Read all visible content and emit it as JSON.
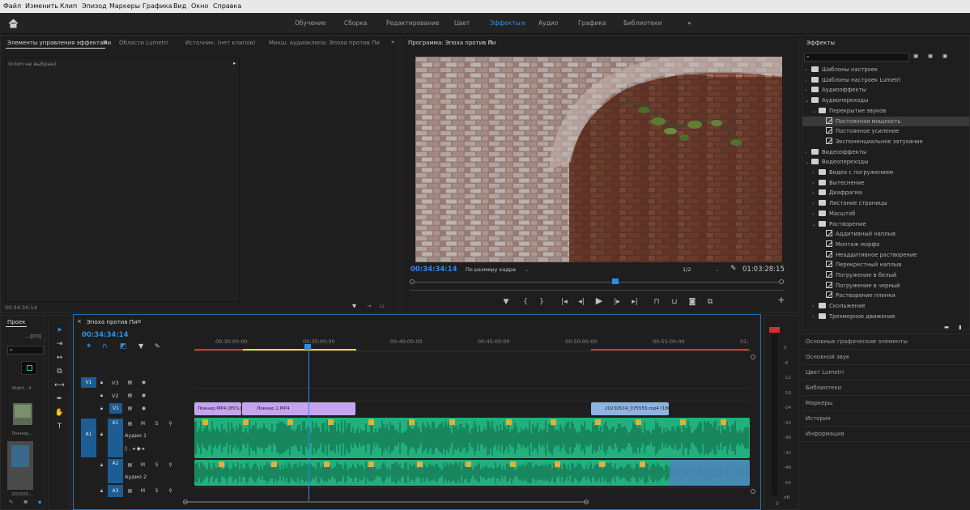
{
  "menu": [
    "Файл",
    "Изменить",
    "Клип",
    "Эпизод",
    "Маркеры",
    "Графика",
    "Вид",
    "Окно",
    "Справка"
  ],
  "workspaces": {
    "items": [
      "Обучение",
      "Сборка",
      "Редактирование",
      "Цвет",
      "Эффекты",
      "Аудио",
      "Графика",
      "Библиотеки"
    ],
    "active": "Эффекты"
  },
  "effect_controls": {
    "tabs": [
      "Элементы управления эффектами",
      "Области Lumetri",
      "Источник: (нет клипов)",
      "Микш. аудиоклипа: Эпоха против Пи"
    ],
    "no_clip": "(клип не выбран)",
    "timecode": "00:34:34:14"
  },
  "program": {
    "title": "Программа: Эпоха против Пи",
    "timecode": "00:34:34:14",
    "fit": "По размеру кадра",
    "resolution": "1/2",
    "duration": "01:03:28:15"
  },
  "effects_panel": {
    "title": "Эффекты",
    "tree": [
      {
        "label": "Шаблоны настроек",
        "level": 0,
        "type": "folder",
        "open": false
      },
      {
        "label": "Шаблоны настроек Lumetri",
        "level": 0,
        "type": "folder",
        "open": false
      },
      {
        "label": "Аудиоэффекты",
        "level": 0,
        "type": "folder",
        "open": false
      },
      {
        "label": "Аудиопереходы",
        "level": 0,
        "type": "folder",
        "open": true
      },
      {
        "label": "Перекрытие звуков",
        "level": 1,
        "type": "folder",
        "open": true
      },
      {
        "label": "Постоянная мощность",
        "level": 2,
        "type": "fx",
        "selected": true
      },
      {
        "label": "Постоянное усиление",
        "level": 2,
        "type": "fx"
      },
      {
        "label": "Экспоненциальное затухание",
        "level": 2,
        "type": "fx"
      },
      {
        "label": "Видеоэффекты",
        "level": 0,
        "type": "folder",
        "open": false
      },
      {
        "label": "Видеопереходы",
        "level": 0,
        "type": "folder",
        "open": true
      },
      {
        "label": "Видео с погружением",
        "level": 1,
        "type": "folder",
        "open": false
      },
      {
        "label": "Вытеснение",
        "level": 1,
        "type": "folder",
        "open": false
      },
      {
        "label": "Диафрагма",
        "level": 1,
        "type": "folder",
        "open": false
      },
      {
        "label": "Листание страницы",
        "level": 1,
        "type": "folder",
        "open": false
      },
      {
        "label": "Масштаб",
        "level": 1,
        "type": "folder",
        "open": false
      },
      {
        "label": "Растворение",
        "level": 1,
        "type": "folder",
        "open": true
      },
      {
        "label": "Аддитивный наплыв",
        "level": 2,
        "type": "fx"
      },
      {
        "label": "Монтаж морфо",
        "level": 2,
        "type": "fx"
      },
      {
        "label": "Неаддитивное растворение",
        "level": 2,
        "type": "fx"
      },
      {
        "label": "Перекрестный наплыв",
        "level": 2,
        "type": "fx"
      },
      {
        "label": "Погружение в белый",
        "level": 2,
        "type": "fx"
      },
      {
        "label": "Погружение в черный",
        "level": 2,
        "type": "fx"
      },
      {
        "label": "Растворение пленки",
        "level": 2,
        "type": "fx"
      },
      {
        "label": "Скольжение",
        "level": 1,
        "type": "folder",
        "open": false
      },
      {
        "label": "Трехмерное движение",
        "level": 1,
        "type": "folder",
        "open": false
      }
    ],
    "sections": [
      "Основные графические элементы",
      "Основной звук",
      "Цвет Lumetri",
      "Библиотеки",
      "Маркеры",
      "История",
      "Информация"
    ]
  },
  "project": {
    "tab": "Проек",
    "items": [
      "Night...4",
      "Локнер...",
      "202305..."
    ],
    "search": "...proj"
  },
  "timeline": {
    "title": "Эпоха против Пи",
    "timecode": "00:34:34:14",
    "ruler": [
      "00:30:00:00",
      "00:35:00:00",
      "00:40:00:00",
      "00:45:00:00",
      "00:50:00:00",
      "00:55:00:00",
      "01:"
    ],
    "tracks": {
      "v3": "V3",
      "v2": "V2",
      "v1": "V1",
      "a1": "A1",
      "a2": "A2",
      "a3": "A3",
      "src_v1": "V1",
      "src_a1": "A1",
      "audio1": "Аудио 1",
      "audio2": "Аудио 2",
      "m": "M",
      "s": "S"
    },
    "video_clips": [
      "Локнер.MP4 [85%]",
      "Локнер 2.MP4",
      "20230514_075555.mp4 [180"
    ],
    "meter_labels": [
      "0",
      "-6",
      "-12",
      "-18",
      "-24",
      "-30",
      "-36",
      "-42",
      "-48",
      "-54",
      "dB"
    ],
    "meter_slider": "0"
  },
  "colors": {
    "accent": "#2d8ceb",
    "video_clip": "#c5a4f0",
    "audio_clip": "#21b07e",
    "audio_sel": "#4d86bc",
    "fx_badge": "#d9b53a",
    "ruler_red": "#d13a3a",
    "ruler_yellow": "#e8d84a"
  }
}
